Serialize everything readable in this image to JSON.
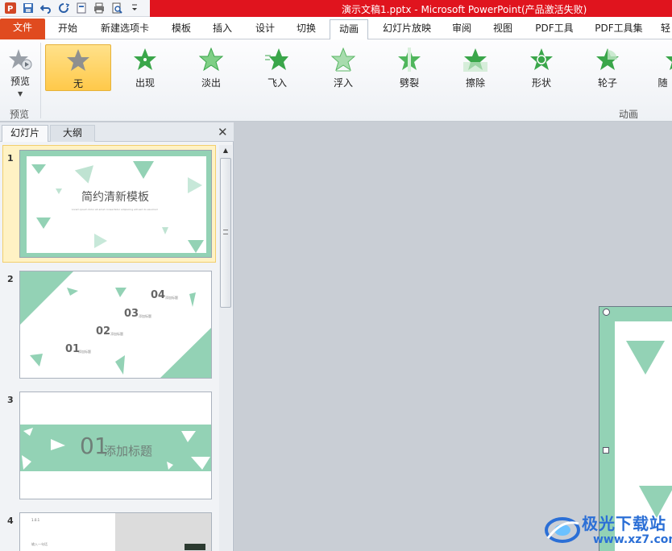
{
  "window": {
    "title": "演示文稿1.pptx - Microsoft PowerPoint(产品激活失败)"
  },
  "tabs": [
    {
      "label": "文件"
    },
    {
      "label": "开始"
    },
    {
      "label": "新建选项卡"
    },
    {
      "label": "模板"
    },
    {
      "label": "插入"
    },
    {
      "label": "设计"
    },
    {
      "label": "切换"
    },
    {
      "label": "动画"
    },
    {
      "label": "幻灯片放映"
    },
    {
      "label": "审阅"
    },
    {
      "label": "视图"
    },
    {
      "label": "PDF工具"
    },
    {
      "label": "PDF工具集"
    },
    {
      "label": "轻"
    }
  ],
  "ribbon": {
    "preview_label": "预览",
    "preview_group": "预览",
    "animation_group": "动画",
    "animations": [
      {
        "label": "无"
      },
      {
        "label": "出现"
      },
      {
        "label": "淡出"
      },
      {
        "label": "飞入"
      },
      {
        "label": "浮入"
      },
      {
        "label": "劈裂"
      },
      {
        "label": "擦除"
      },
      {
        "label": "形状"
      },
      {
        "label": "轮子"
      },
      {
        "label": "随机"
      }
    ]
  },
  "panel": {
    "tab_slides": "幻灯片",
    "tab_outline": "大纲",
    "close": "✕"
  },
  "slides": [
    {
      "number": "1",
      "title": "简约清新模板",
      "subtitle": "Lorem ipsum dolor sit amet consectetur adipiscing elit sed do eiusmod"
    },
    {
      "number": "2",
      "items": [
        "04",
        "03",
        "02",
        "01"
      ],
      "item_label": "添加标题"
    },
    {
      "number": "3",
      "big": "01",
      "title": "添加标题"
    },
    {
      "number": "4",
      "heading": "1.0.1",
      "caption": "输入一句话"
    }
  ],
  "watermark": {
    "text": "极光下载站",
    "url": "www.xz7.com"
  },
  "colors": {
    "accent_mint": "#93d2b5",
    "title_red": "#e0141e",
    "file_tab": "#e04b1f",
    "selected": "#ffc94a"
  }
}
